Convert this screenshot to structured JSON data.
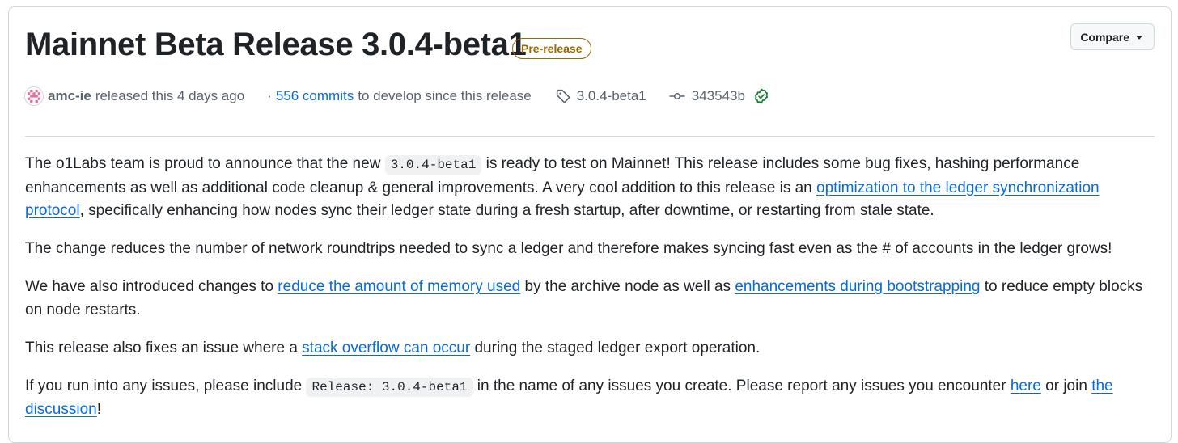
{
  "release": {
    "title": "Mainnet Beta Release 3.0.4-beta1",
    "badge": "Pre-release",
    "compare_label": "Compare"
  },
  "meta": {
    "author": "amc-ie",
    "released_text": "released this 4 days ago",
    "separator": "·",
    "commits_link": "556 commits",
    "commits_suffix": "to develop since this release",
    "tag": "3.0.4-beta1",
    "commit_sha": "343543b",
    "icons": {
      "avatar": "identicon-avatar",
      "tag": "tag-icon",
      "commit": "git-commit-icon",
      "verified": "check-circle-icon"
    },
    "colors": {
      "link": "#0969da",
      "prerelease": "#9a6700",
      "verified": "#1a7f37",
      "avatar": "#e66e9b"
    }
  },
  "notes": {
    "p1": {
      "t1": "The o1Labs team is proud to announce that the new ",
      "code": "3.0.4-beta1",
      "t2": " is ready to test on Mainnet! This release includes some bug fixes, hashing performance enhancements as well as additional code cleanup & general improvements. A very cool addition to this release is an ",
      "link": "optimization to the ledger synchronization protocol",
      "t3": ", specifically enhancing how nodes sync their ledger state during a fresh startup, after downtime, or restarting from stale state."
    },
    "p2": {
      "text": "The change reduces the number of network roundtrips needed to sync a ledger and therefore makes syncing fast even as the # of accounts in the ledger grows!"
    },
    "p3": {
      "t1": "We have also introduced changes to ",
      "link1": "reduce the amount of memory used",
      "t2": " by the archive node as well as ",
      "link2": "enhancements during bootstrapping",
      "t3": " to reduce empty blocks on node restarts."
    },
    "p4": {
      "t1": "This release also fixes an issue where a ",
      "link": "stack overflow can occur",
      "t2": " during the staged ledger export operation."
    },
    "p5": {
      "t1": "If you run into any issues, please include ",
      "code": "Release: 3.0.4-beta1",
      "t2": " in the name of any issues you create. Please report any issues you encounter ",
      "link1": "here",
      "t3": " or join ",
      "link2": "the discussion",
      "t4": "!"
    }
  }
}
